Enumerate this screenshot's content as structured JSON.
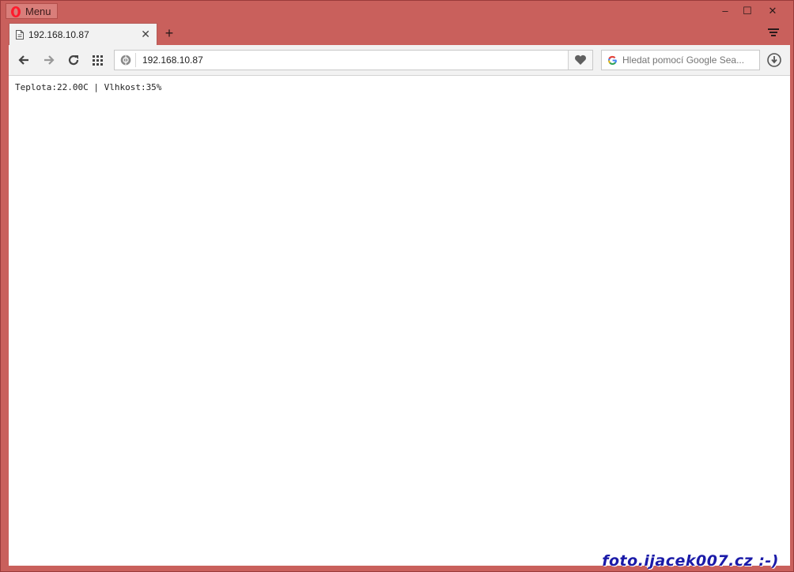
{
  "titlebar": {
    "menu_label": "Menu",
    "icons": {
      "logo": "opera-logo-icon",
      "minimize": "minimize-icon",
      "maximize": "maximize-icon",
      "close": "close-icon"
    },
    "minimize_glyph": "–",
    "maximize_glyph": "☐",
    "close_glyph": "✕"
  },
  "tabs": [
    {
      "title": "192.168.10.87",
      "close_glyph": "✕"
    }
  ],
  "newtab_glyph": "+",
  "toolbar": {
    "address": "192.168.10.87",
    "search_placeholder": "Hledat pomocí Google Sea..."
  },
  "page": {
    "text": "Teplota:22.00C | Vlhkost:35%"
  },
  "watermark": "foto.ijacek007.cz :-)",
  "colors": {
    "accent": "#c9605c",
    "toolbar": "#f2f2f2",
    "watermark": "#1a1aa8"
  }
}
